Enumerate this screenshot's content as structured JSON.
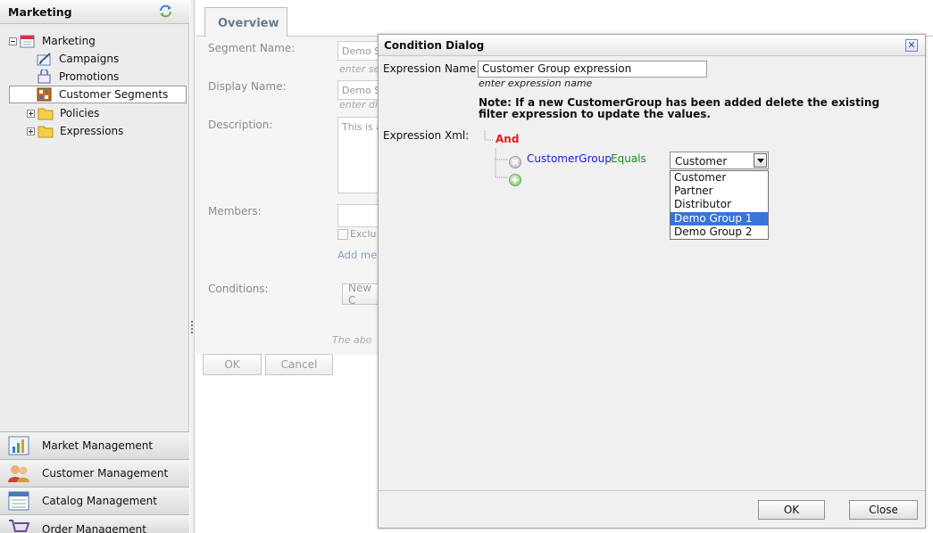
{
  "sidebar": {
    "title": "Marketing",
    "refresh_icon": "refresh-icon",
    "tree": [
      {
        "label": "Marketing",
        "icon": "calendar-icon"
      },
      {
        "label": "Campaigns",
        "icon": "campaign-pen-icon"
      },
      {
        "label": "Promotions",
        "icon": "gift-icon"
      },
      {
        "label": "Customer Segments",
        "icon": "segments-icon"
      },
      {
        "label": "Policies",
        "icon": "folder-icon"
      },
      {
        "label": "Expressions",
        "icon": "folder-icon"
      }
    ],
    "sections": [
      {
        "label": "Market Management",
        "icon": "market-chart-icon"
      },
      {
        "label": "Customer Management",
        "icon": "users-icon"
      },
      {
        "label": "Catalog Management",
        "icon": "catalog-icon"
      },
      {
        "label": "Order Management",
        "icon": "cart-icon"
      }
    ]
  },
  "form": {
    "tab": "Overview",
    "segment_name_label": "Segment Name:",
    "segment_name_value": "Demo S",
    "segment_name_hint": "enter se",
    "display_name_label": "Display Name:",
    "display_name_value": "Demo S",
    "display_name_hint": "enter di",
    "description_label": "Description:",
    "description_value": "This is a",
    "members_label": "Members:",
    "exclude_label": "Exclu",
    "add_members_link": "Add me",
    "conditions_label": "Conditions:",
    "new_condition_button": "New C",
    "above_note": "The abo",
    "ok_button": "OK",
    "cancel_button": "Cancel"
  },
  "dialog": {
    "title": "Condition Dialog",
    "close_glyph": "✕",
    "expression_name_label": "Expression Name:",
    "expression_name_value": "Customer Group expression",
    "expression_name_hint": "enter expression name",
    "note": "Note: If a new CustomerGroup has been added delete the existing filter expression to update the values.",
    "expression_xml_label": "Expression Xml:",
    "and_label": "And",
    "field": "CustomerGroup",
    "operator": "Equals",
    "selected_value": "Customer",
    "options": [
      "Customer",
      "Partner",
      "Distributor",
      "Demo Group 1",
      "Demo Group 2"
    ],
    "highlighted_option": "Demo Group 1",
    "ok_button": "OK",
    "close_button": "Close"
  },
  "colors": {
    "and_operator": "#e02020",
    "field_name": "#1a1ad6",
    "operator_text": "#1c8a1c",
    "dropdown_highlight": "#3875d7"
  }
}
